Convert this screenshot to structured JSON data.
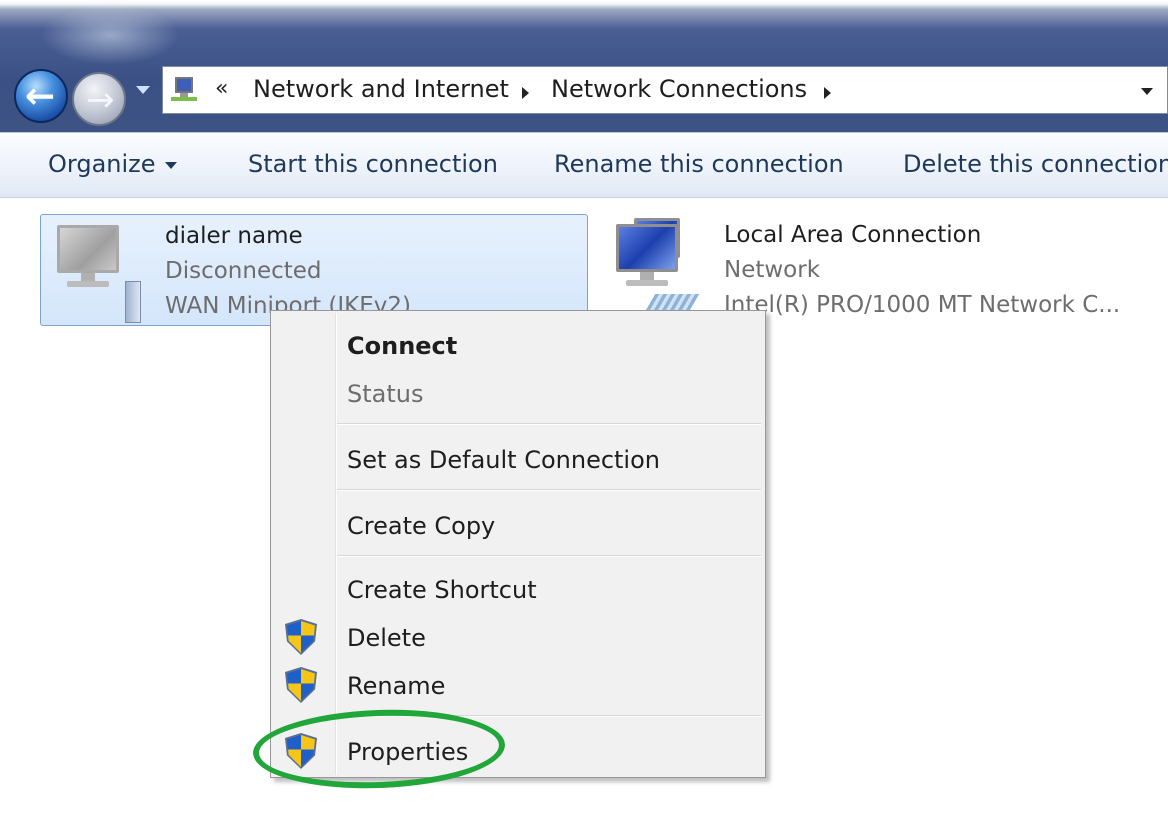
{
  "address_bar": {
    "overflow": "«",
    "breadcrumbs": [
      "Network and Internet",
      "Network Connections"
    ]
  },
  "toolbar": {
    "organize": "Organize",
    "start": "Start this connection",
    "rename": "Rename this connection",
    "delete": "Delete this connection"
  },
  "items": [
    {
      "name": "dialer name",
      "status": "Disconnected",
      "device": "WAN Miniport (IKEv2)"
    },
    {
      "name": "Local Area Connection",
      "status": "Network",
      "device": "Intel(R) PRO/1000 MT Network C..."
    }
  ],
  "context_menu": {
    "items": [
      {
        "label": "Connect",
        "bold": true,
        "icon": null
      },
      {
        "label": "Status",
        "disabled": true,
        "icon": null
      },
      {
        "label": "Set as Default Connection",
        "icon": null
      },
      {
        "label": "Create Copy",
        "icon": null
      },
      {
        "label": "Create Shortcut",
        "icon": null
      },
      {
        "label": "Delete",
        "icon": "uac-shield-icon"
      },
      {
        "label": "Rename",
        "icon": "uac-shield-icon"
      },
      {
        "label": "Properties",
        "icon": "uac-shield-icon"
      }
    ]
  },
  "colors": {
    "selection_bg": "#d4e6fb",
    "annotation_ellipse": "#21a63a",
    "titlebar": "#3b5186"
  }
}
